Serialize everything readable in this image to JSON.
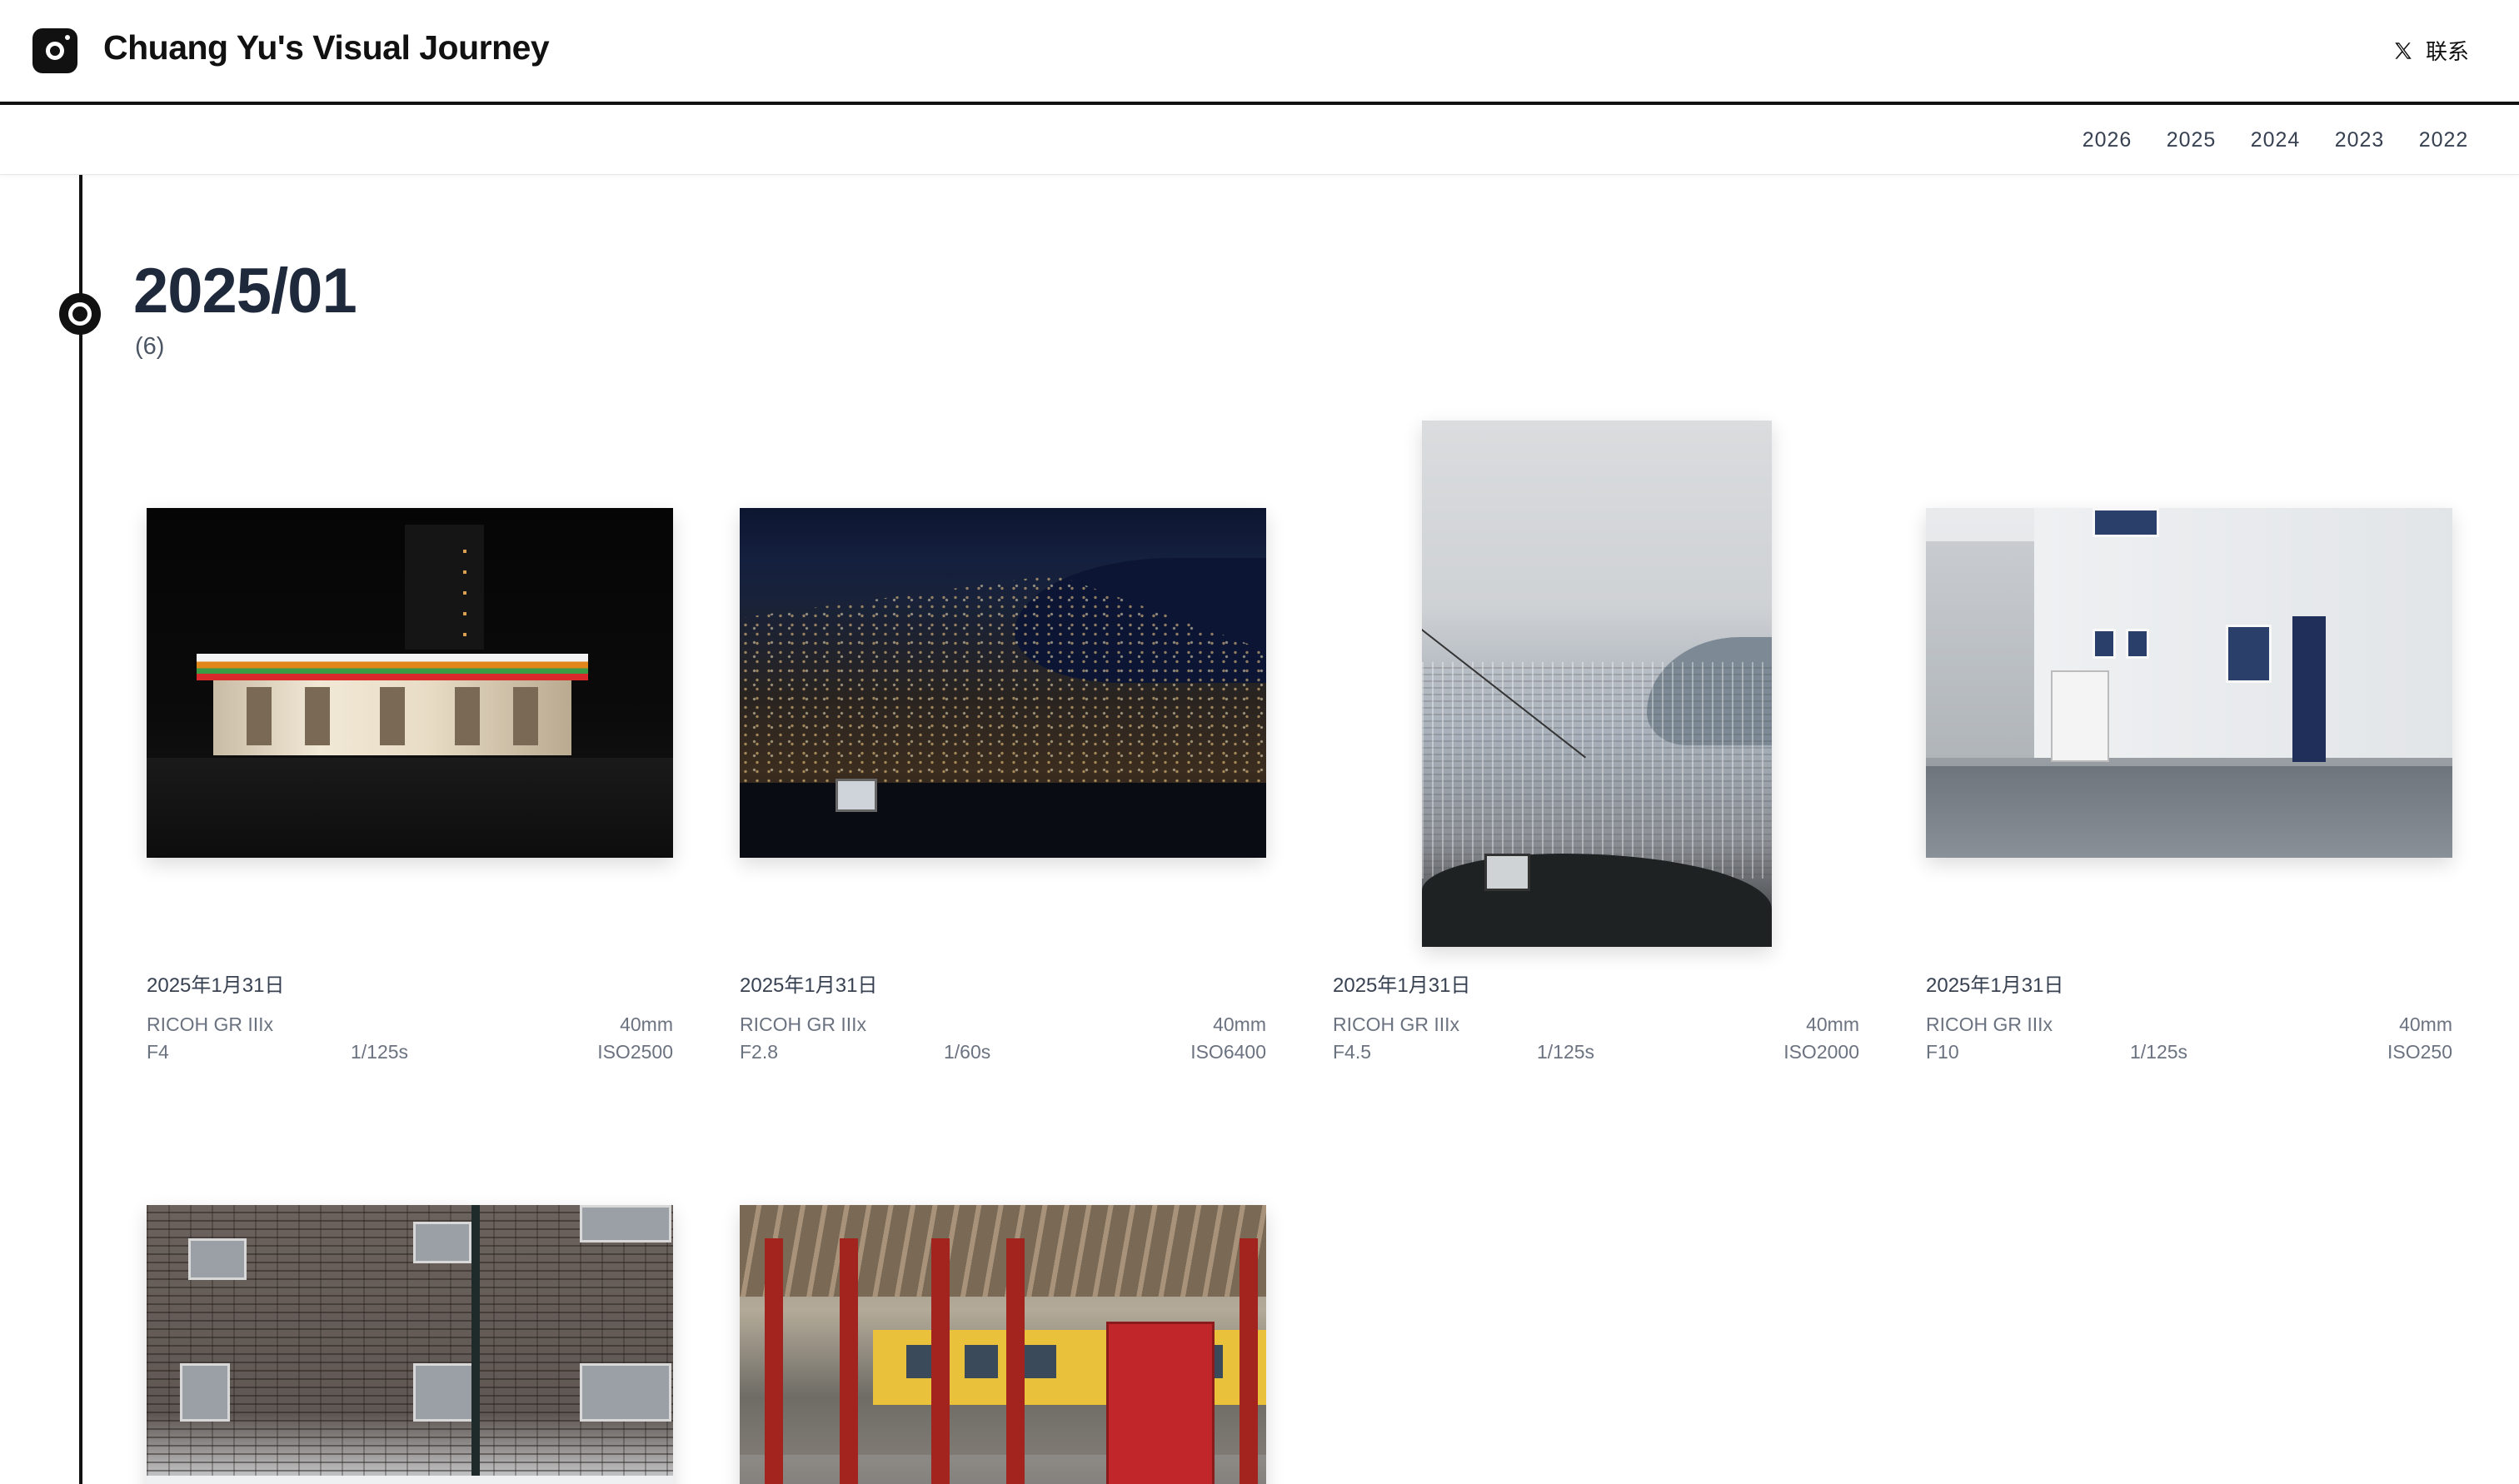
{
  "header": {
    "title": "Chuang Yu's Visual Journey",
    "contact_label": "联系"
  },
  "year_nav": {
    "years": [
      "2026",
      "2025",
      "2024",
      "2023",
      "2022"
    ]
  },
  "section": {
    "month": "2025/01",
    "count": "(6)"
  },
  "photos": [
    {
      "date": "2025年1月31日",
      "camera": "RICOH GR IIIx",
      "focal": "40mm",
      "aperture": "F4",
      "shutter": "1/125s",
      "iso": "ISO2500"
    },
    {
      "date": "2025年1月31日",
      "camera": "RICOH GR IIIx",
      "focal": "40mm",
      "aperture": "F2.8",
      "shutter": "1/60s",
      "iso": "ISO6400"
    },
    {
      "date": "2025年1月31日",
      "camera": "RICOH GR IIIx",
      "focal": "40mm",
      "aperture": "F4.5",
      "shutter": "1/125s",
      "iso": "ISO2000"
    },
    {
      "date": "2025年1月31日",
      "camera": "RICOH GR IIIx",
      "focal": "40mm",
      "aperture": "F10",
      "shutter": "1/125s",
      "iso": "ISO250"
    }
  ],
  "colors": {
    "accent": "#111111",
    "text": "#1e293b",
    "muted": "#6b7280"
  }
}
